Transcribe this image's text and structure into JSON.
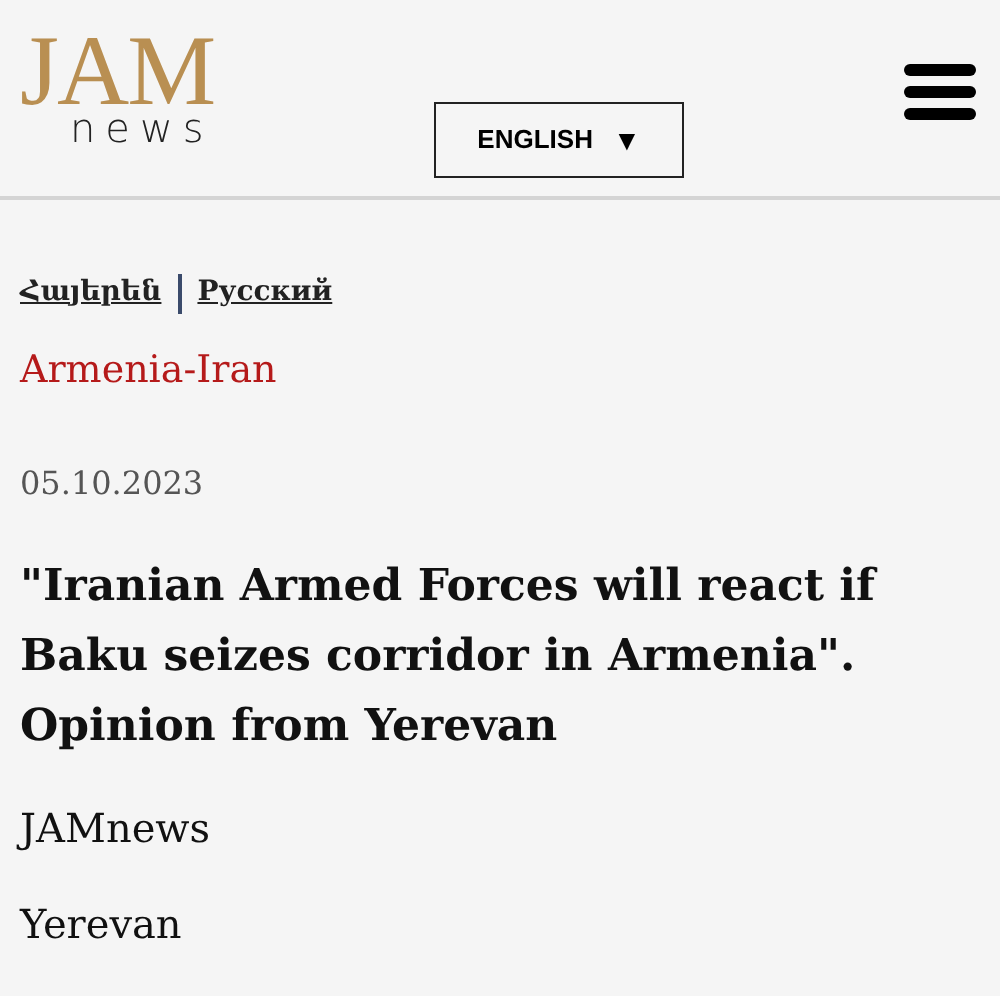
{
  "header": {
    "logo_main": "JAM",
    "logo_sub": "news",
    "language_button": "ENGLISH",
    "language_caret": "▼"
  },
  "translations": [
    {
      "label": "Հայերեն"
    },
    {
      "label": "Русский"
    }
  ],
  "category": "Armenia-Iran",
  "date": "05.10.2023",
  "title": "\"Iranian Armed Forces will react if Baku seizes corridor in Armenia\". Opinion from Yerevan",
  "author": "JAMnews",
  "location": "Yerevan"
}
